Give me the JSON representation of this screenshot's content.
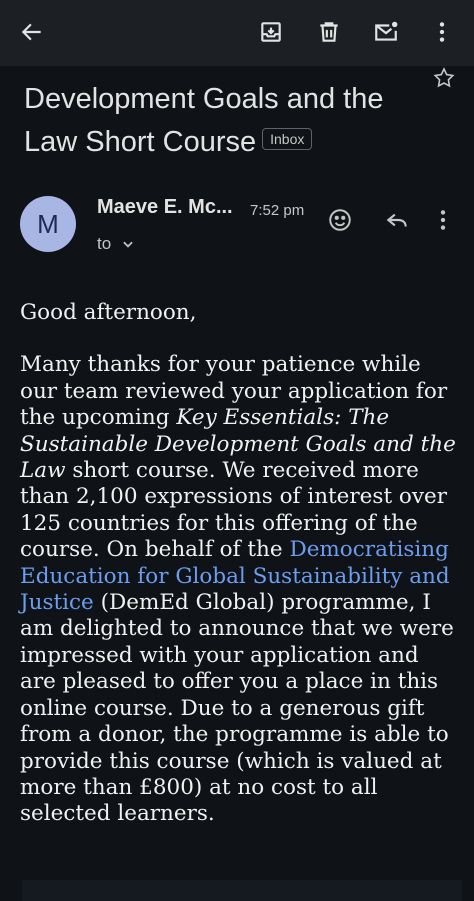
{
  "topbar": {
    "icons": [
      "back-arrow-icon",
      "archive-icon",
      "delete-icon",
      "mark-unread-icon",
      "more-vert-icon"
    ]
  },
  "email": {
    "subject": "Development Goals and the Law Short Course",
    "label": "Inbox",
    "sender_initial": "M",
    "sender_name": "Maeve E. Mc...",
    "time": "7:52 pm",
    "to_label": "to"
  },
  "body": {
    "greeting": "Good afternoon,",
    "p1_a": "Many thanks for your patience while our team reviewed your application for the upcoming ",
    "p1_italic": "Key Essentials: The Sustainable Development Goals and the Law",
    "p1_b": " short course. We received more than 2,100 expressions of interest over 125 countries for this offering of the course. On behalf of the ",
    "p1_link": "Democratising Education for Global Sustainability and Justice",
    "p1_c": " (DemEd Global) programme, I am delighted to announce that we were impressed with your application and are pleased to offer you a place in this online course. Due to a generous gift from a donor, the programme is able to provide this course (which is valued at more than £800) at no cost to all selected learners."
  },
  "colors": {
    "background": "#0f1217",
    "toolbar": "#1c2025",
    "link": "#6b9ef0",
    "avatar": "#a8b6e6"
  }
}
